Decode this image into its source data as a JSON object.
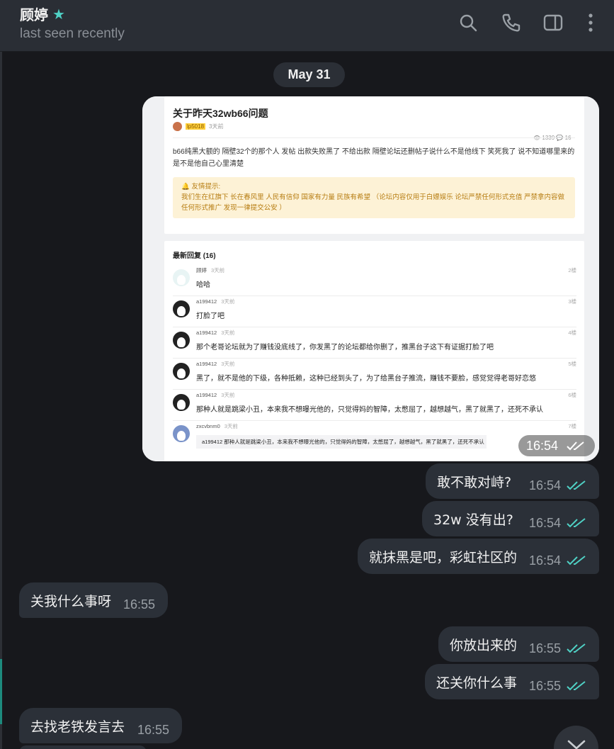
{
  "header": {
    "contact_name": "顾婷",
    "status": "last seen recently",
    "icons": [
      "search-icon",
      "phone-icon",
      "sidebar-icon",
      "more-vertical-icon"
    ]
  },
  "chat": {
    "date_label": "May 31",
    "photo_message": {
      "time": "16:54",
      "screenshot": {
        "title": "关于昨天32wb66问题",
        "author_badge": "lp5018",
        "posted_ago": "3天前",
        "stats": "👁 1339 💬 16",
        "body": "b66纯黑大额的 隔壁32个的那个人 发帖 出款失败黑了 不给出款 隔壁论坛还删帖子说什么不是他线下 笑死我了 说不知道哪里来的 是不是他自己心里清楚",
        "notice_title": "🔔 友情提示:",
        "notice_body": "我们生在红旗下 长在春风里 人民有信仰 国家有力量 民族有希望 （论坛内容仅用于白嫖娱乐 论坛严禁任何形式充值 严禁拿内容做任何形式推广 发现一律提交公安 ）",
        "replies_header": "最新回复 (16)",
        "replies": [
          {
            "user": "顾婷",
            "ago": "3天前",
            "floor": "2楼",
            "text": "哈哈"
          },
          {
            "user": "a199412",
            "ago": "3天前",
            "floor": "3楼",
            "text": "打脸了吧"
          },
          {
            "user": "a199412",
            "ago": "3天前",
            "floor": "4楼",
            "text": "那个老哥论坛就为了赚钱没底线了，你发黑了的论坛都给你删了，推黑台子这下有证据打脸了吧"
          },
          {
            "user": "a199412",
            "ago": "3天前",
            "floor": "5楼",
            "text": "黑了，就不是他的下级，各种抵赖，这种已经到头了，为了给黑台子推流，赚钱不要脸，感觉觉得老哥好恋悠"
          },
          {
            "user": "a199412",
            "ago": "3天前",
            "floor": "6楼",
            "text": "那种人就是跳梁小丑，本来我不想曝光他的，只觉得妈的智障，太憋屈了，越想越气，黑了就黑了，还死不承认"
          },
          {
            "user": "zxcvbnm0",
            "ago": "3天前",
            "floor": "7楼",
            "text": "a199412  那种人就是跳梁小丑，本来我不想曝光他的，只觉得妈的智障，太憋屈了，越想越气，黑了就黑了，还死不承认"
          }
        ]
      }
    },
    "messages": [
      {
        "dir": "out",
        "text": "敢不敢对峙?",
        "time": "16:54",
        "read": true
      },
      {
        "dir": "out",
        "text": "32w 没有出?",
        "time": "16:54",
        "read": true
      },
      {
        "dir": "out",
        "text": "就抹黑是吧，彩虹社区的",
        "time": "16:54",
        "read": true
      },
      {
        "dir": "in",
        "text": "关我什么事呀",
        "time": "16:55"
      },
      {
        "dir": "out",
        "text": "你放出来的",
        "time": "16:55",
        "read": true
      },
      {
        "dir": "out",
        "text": "还关你什么事",
        "time": "16:55",
        "read": true
      },
      {
        "dir": "in",
        "text": "去找老铁发言去",
        "time": "16:55"
      }
    ]
  },
  "colors": {
    "background": "#17181c",
    "header": "#2a2e35",
    "bubble": "#2b3038",
    "read_ticks": "#4fd1c5"
  }
}
